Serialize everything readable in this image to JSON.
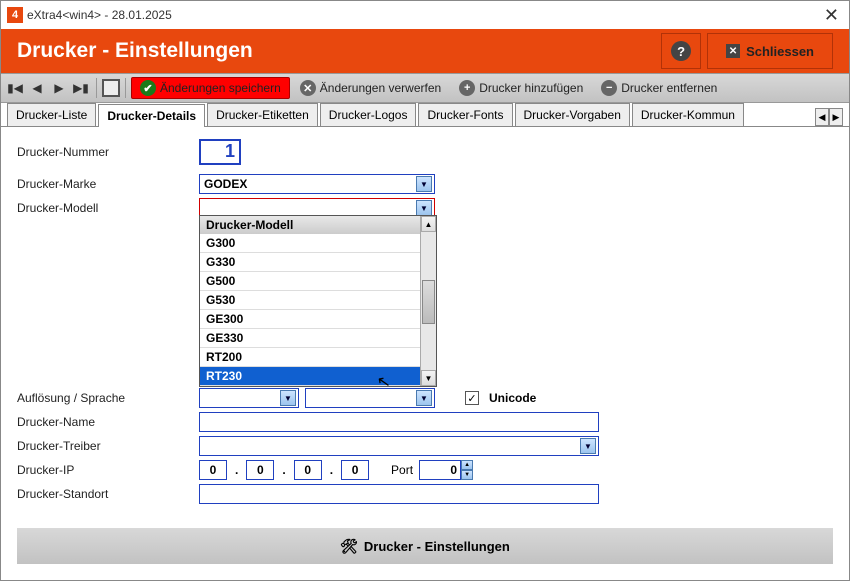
{
  "window": {
    "title": "eXtra4<win4>  -  28.01.2025"
  },
  "header": {
    "title": "Drucker - Einstellungen",
    "close": "Schliessen"
  },
  "toolbar": {
    "save": "Änderungen speichern",
    "discard": "Änderungen verwerfen",
    "add": "Drucker hinzufügen",
    "remove": "Drucker entfernen"
  },
  "tabs": {
    "t0": "Drucker-Liste",
    "t1": "Drucker-Details",
    "t2": "Drucker-Etiketten",
    "t3": "Drucker-Logos",
    "t4": "Drucker-Fonts",
    "t5": "Drucker-Vorgaben",
    "t6": "Drucker-Kommun"
  },
  "labels": {
    "number": "Drucker-Nummer",
    "brand": "Drucker-Marke",
    "model": "Drucker-Modell",
    "resolution": "Auflösung / Sprache",
    "name": "Drucker-Name",
    "driver": "Drucker-Treiber",
    "ip": "Drucker-IP",
    "port": "Port",
    "location": "Drucker-Standort",
    "unicode": "Unicode"
  },
  "values": {
    "number": "1",
    "brand": "GODEX",
    "model": "",
    "ip": {
      "a": "0",
      "b": "0",
      "c": "0",
      "d": "0"
    },
    "port": "0",
    "unicode_checked": "✓"
  },
  "dropdown": {
    "header": "Drucker-Modell",
    "i0": "G300",
    "i1": "G330",
    "i2": "G500",
    "i3": "G530",
    "i4": "GE300",
    "i5": "GE330",
    "i6": "RT200",
    "i7": "RT230"
  },
  "bottom": {
    "label": "Drucker - Einstellungen"
  }
}
